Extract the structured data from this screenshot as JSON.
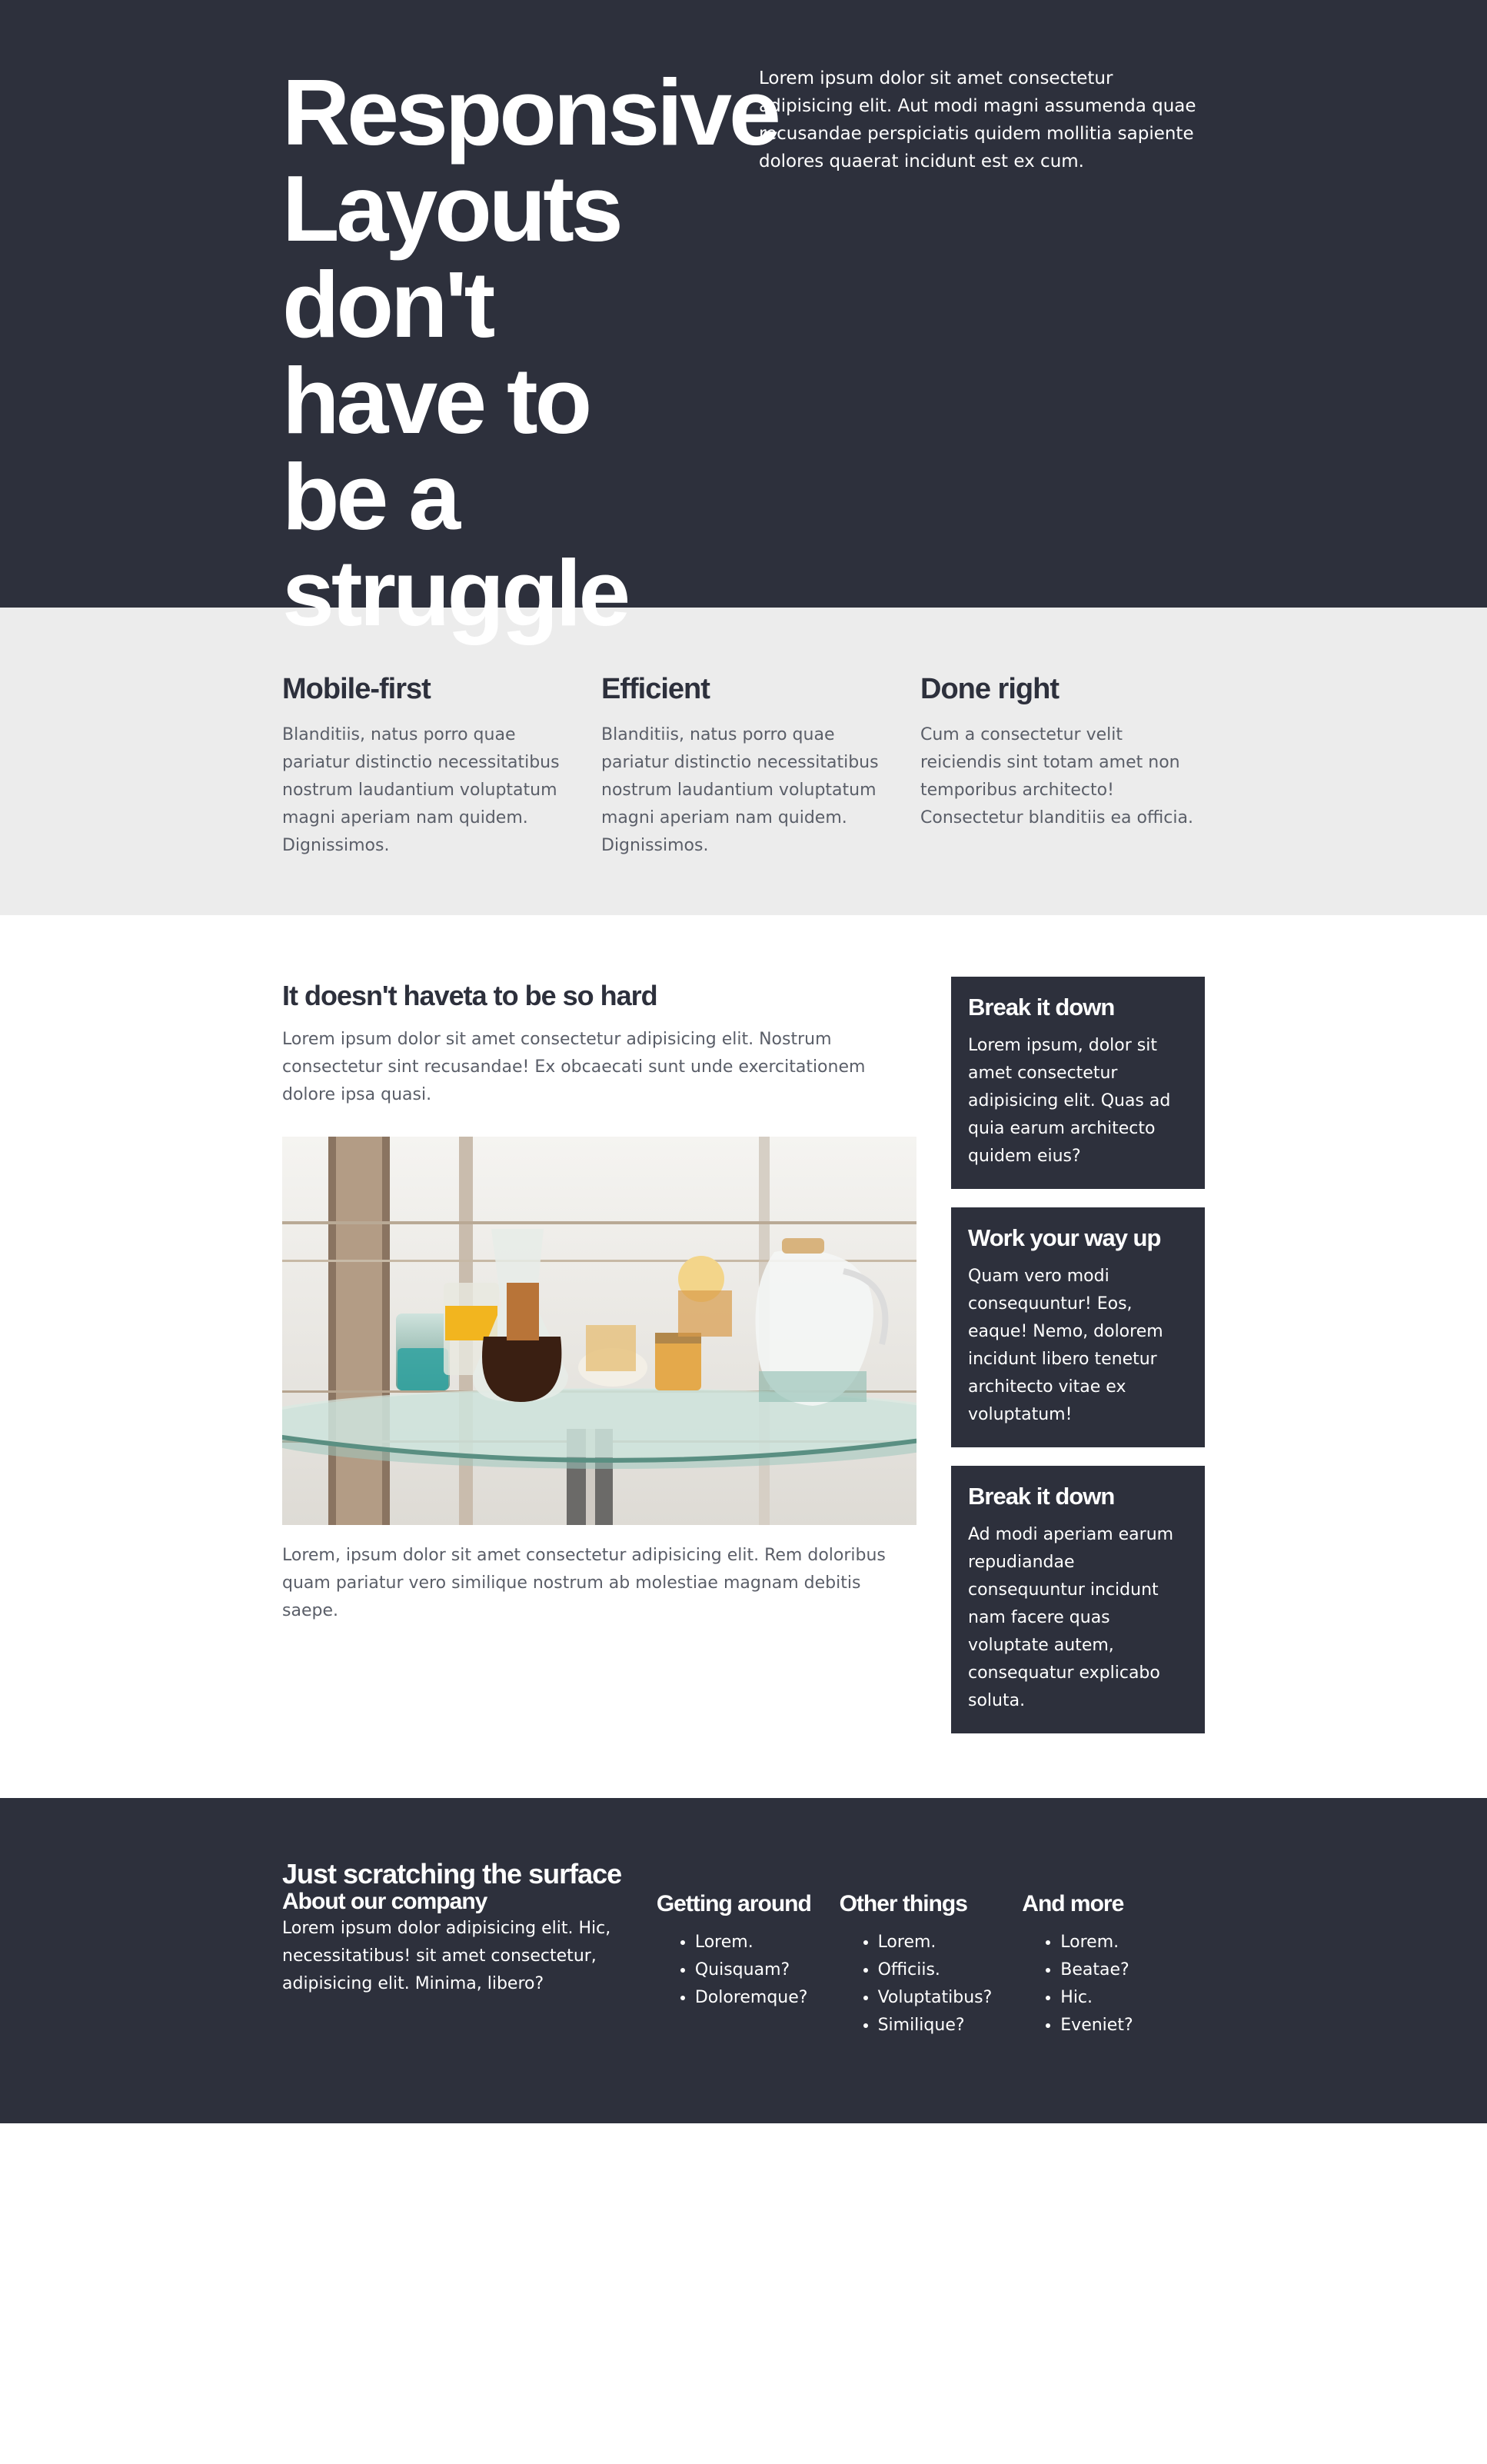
{
  "hero": {
    "title": "Responsive Layouts don't have to be a struggle",
    "text": "Lorem ipsum dolor sit amet consectetur adipisicing elit. Aut modi magni assumenda quae recusandae perspiciatis quidem mollitia sapiente dolores quaerat incidunt est ex cum."
  },
  "features": [
    {
      "title": "Mobile-first",
      "text": "Blanditiis, natus porro quae pariatur distinctio necessitatibus nostrum laudantium voluptatum magni aperiam nam quidem. Dignissimos."
    },
    {
      "title": "Efficient",
      "text": "Blanditiis, natus porro quae pariatur distinctio necessitatibus nostrum laudantium voluptatum magni aperiam nam quidem. Dignissimos."
    },
    {
      "title": "Done right",
      "text": "Cum a consectetur velit reiciendis sint totam amet non temporibus architecto! Consectetur blanditiis ea officia."
    }
  ],
  "article": {
    "title": "It doesn't haveta to be so hard",
    "intro": "Lorem ipsum dolor sit amet consectetur adipisicing elit. Nostrum consectetur sint recusandae! Ex obcaecati sunt unde exercitationem dolore ipsa quasi.",
    "outro": "Lorem, ipsum dolor sit amet consectetur adipisicing elit. Rem doloribus quam pariatur vero similique nostrum ab molestiae magnam debitis saepe."
  },
  "cards": [
    {
      "title": "Break it down",
      "text": "Lorem ipsum, dolor sit amet consectetur adipisicing elit. Quas ad quia earum architecto quidem eius?"
    },
    {
      "title": "Work your way up",
      "text": "Quam vero modi consequuntur! Eos, eaque! Nemo, dolorem incidunt libero tenetur architecto vitae ex voluptatum!"
    },
    {
      "title": "Break it down",
      "text": "Ad modi aperiam earum repudiandae consequuntur incidunt nam facere quas voluptate autem, consequatur explicabo soluta."
    }
  ],
  "footer": {
    "heading": "Just scratching the surface",
    "about_title": "About our company",
    "about_text": "Lorem ipsum dolor adipisicing elit. Hic, necessitatibus! sit amet consectetur, adipisicing elit. Minima, libero?",
    "columns": [
      {
        "title": "Getting around",
        "items": [
          "Lorem.",
          "Quisquam?",
          "Doloremque?"
        ]
      },
      {
        "title": "Other things",
        "items": [
          "Lorem.",
          "Officiis.",
          "Voluptatibus?",
          "Similique?"
        ]
      },
      {
        "title": "And more",
        "items": [
          "Lorem.",
          "Beatae?",
          "Hic.",
          "Eveniet?"
        ]
      }
    ]
  },
  "colors": {
    "dark": "#2d303c",
    "light_gray": "#ececec",
    "text": "#5a5e68"
  }
}
